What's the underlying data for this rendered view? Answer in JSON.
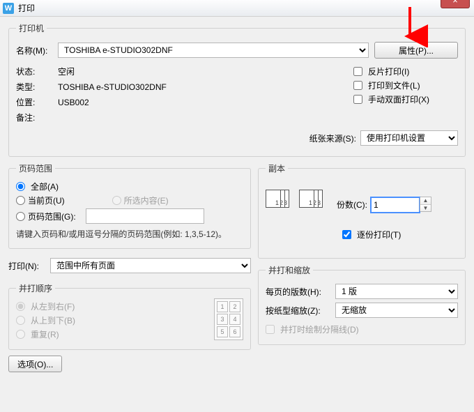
{
  "title": "打印",
  "close": "×",
  "printer": {
    "legend": "打印机",
    "name_label": "名称(M):",
    "name_value": "TOSHIBA e-STUDIO302DNF",
    "properties_btn": "属性(P)...",
    "status_label": "状态:",
    "status_value": "空闲",
    "type_label": "类型:",
    "type_value": "TOSHIBA e-STUDIO302DNF",
    "where_label": "位置:",
    "where_value": "USB002",
    "comment_label": "备注:",
    "reverse": "反片打印(I)",
    "to_file": "打印到文件(L)",
    "manual_duplex": "手动双面打印(X)",
    "paper_source_label": "纸张来源(S):",
    "paper_source_value": "使用打印机设置"
  },
  "range": {
    "legend": "页码范围",
    "all": "全部(A)",
    "current": "当前页(U)",
    "selection": "所选内容(E)",
    "pages": "页码范围(G):",
    "hint": "请键入页码和/或用逗号分隔的页码范围(例如: 1,3,5-12)。"
  },
  "copies": {
    "legend": "副本",
    "count_label": "份数(C):",
    "count_value": "1",
    "collate": "逐份打印(T)"
  },
  "print_what": {
    "label": "打印(N):",
    "value": "范围中所有页面"
  },
  "order": {
    "legend": "并打顺序",
    "lr": "从左到右(F)",
    "tb": "从上到下(B)",
    "repeat": "重复(R)",
    "cells": [
      "1",
      "2",
      "3",
      "4",
      "5",
      "6"
    ]
  },
  "zoom": {
    "legend": "并打和缩放",
    "pages_per_label": "每页的版数(H):",
    "pages_per_value": "1 版",
    "scale_label": "按纸型缩放(Z):",
    "scale_value": "无缩放",
    "draw_lines": "并打时绘制分隔线(D)"
  },
  "options_btn": "选项(O)..."
}
